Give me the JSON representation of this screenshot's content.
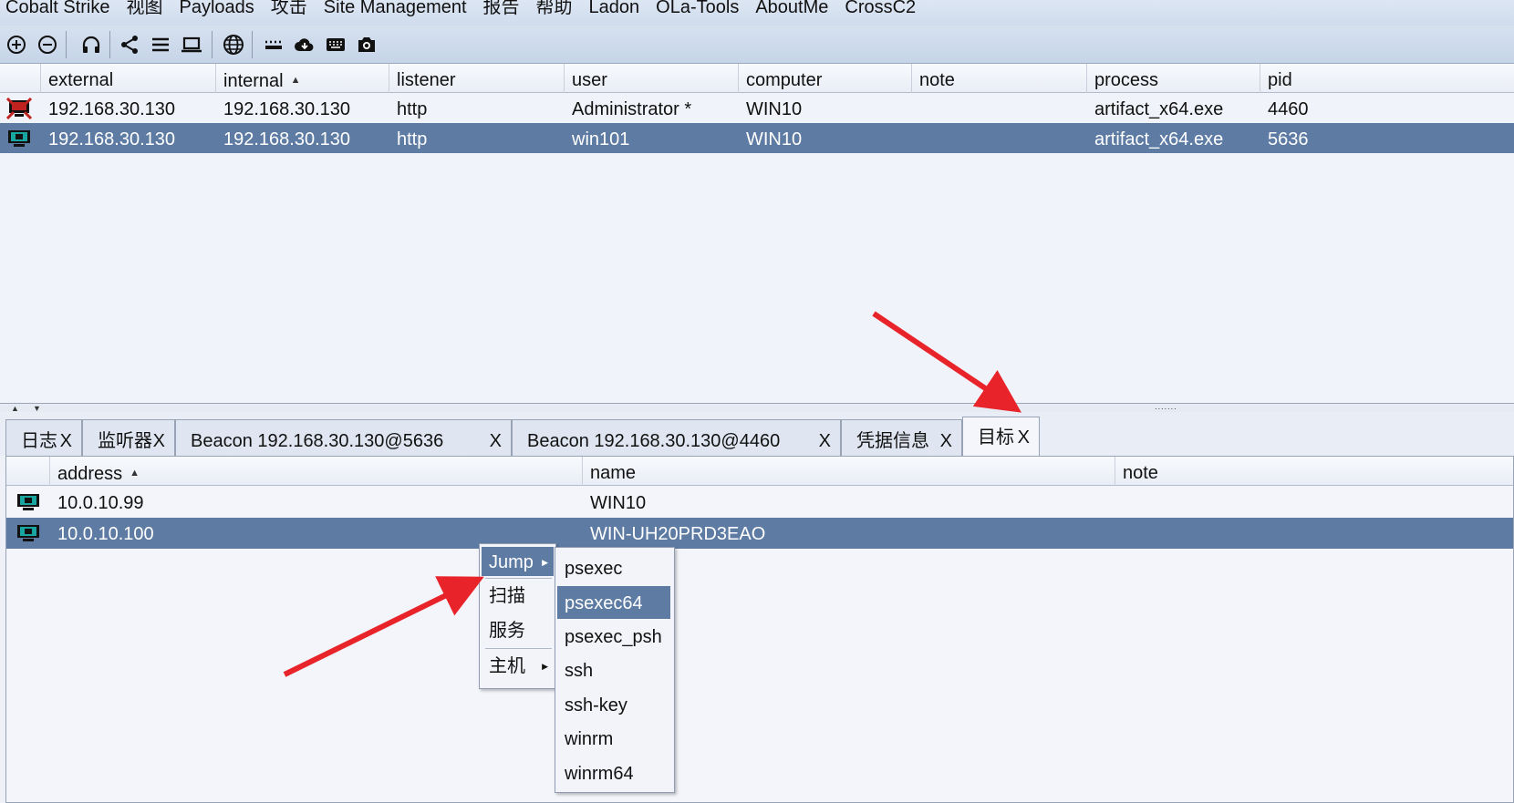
{
  "menubar": {
    "items": [
      "Cobalt Strike",
      "视图",
      "Payloads",
      "攻击",
      "Site Management",
      "报告",
      "帮助",
      "Ladon",
      "OLa-Tools",
      "AboutMe",
      "CrossC2"
    ]
  },
  "toolbar": {
    "icons": [
      "add-icon",
      "remove-icon",
      "headphones-icon",
      "share-icon",
      "list-icon",
      "laptop-icon",
      "globe-icon",
      "keyboard-dots-icon",
      "cloud-download-icon",
      "keyboard-icon",
      "camera-icon"
    ]
  },
  "sessions": {
    "columns": [
      "external",
      "internal",
      "listener",
      "user",
      "computer",
      "note",
      "process",
      "pid"
    ],
    "sorted_column": "internal",
    "rows": [
      {
        "external": "192.168.30.130",
        "internal": "192.168.30.130",
        "listener": "http",
        "user": "Administrator *",
        "computer": "WIN10",
        "note": "",
        "process": "artifact_x64.exe",
        "pid": "4460",
        "icon": "compromised-host-icon",
        "selected": false
      },
      {
        "external": "192.168.30.130",
        "internal": "192.168.30.130",
        "listener": "http",
        "user": "win101",
        "computer": "WIN10",
        "note": "",
        "process": "artifact_x64.exe",
        "pid": "5636",
        "icon": "host-monitor-icon",
        "selected": true
      }
    ]
  },
  "tabs": [
    {
      "label": "日志",
      "close": "X",
      "active": false
    },
    {
      "label": "监听器",
      "close": "X",
      "active": false
    },
    {
      "label": "Beacon 192.168.30.130@5636",
      "close": "X",
      "active": false
    },
    {
      "label": "Beacon 192.168.30.130@4460",
      "close": "X",
      "active": false
    },
    {
      "label": "凭据信息",
      "close": "X",
      "active": false
    },
    {
      "label": "目标",
      "close": "X",
      "active": true
    }
  ],
  "targets": {
    "columns": [
      "address",
      "name",
      "note"
    ],
    "sorted_column": "address",
    "rows": [
      {
        "address": "10.0.10.99",
        "name": "WIN10",
        "note": "",
        "selected": false
      },
      {
        "address": "10.0.10.100",
        "name": "WIN-UH20PRD3EAO",
        "note": "",
        "selected": true
      }
    ]
  },
  "context_menu": {
    "items": [
      {
        "label": "Jump",
        "submenu": true,
        "highlighted": true
      },
      {
        "label": "扫描",
        "submenu": false,
        "highlighted": false
      },
      {
        "label": "服务",
        "submenu": false,
        "highlighted": false
      },
      {
        "label": "主机",
        "submenu": true,
        "highlighted": false
      }
    ]
  },
  "jump_submenu": {
    "items": [
      "psexec",
      "psexec64",
      "psexec_psh",
      "ssh",
      "ssh-key",
      "winrm",
      "winrm64"
    ],
    "highlighted": "psexec64"
  },
  "colors": {
    "selection": "#5d7ba3",
    "annotation_arrow": "#e8232a",
    "toolbar": "#cbd8ea"
  }
}
